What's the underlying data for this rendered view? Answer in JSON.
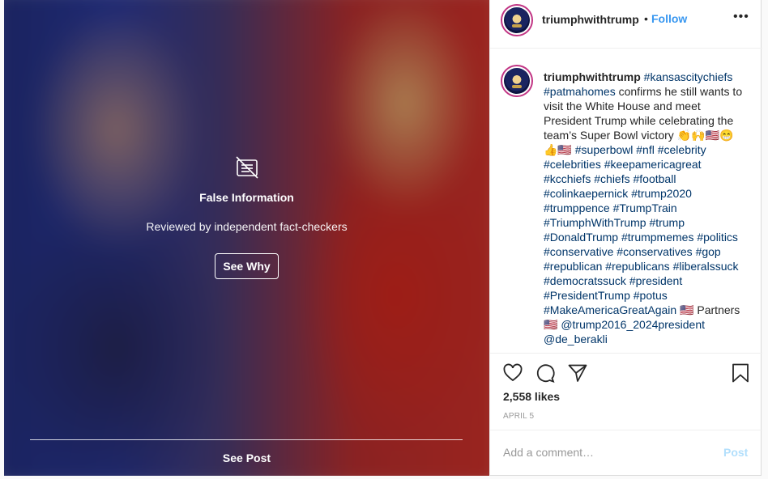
{
  "post": {
    "username": "triumphwithtrump",
    "follow_dot": "•",
    "follow_label": "Follow",
    "more_label": "•••",
    "likes": "2,558 likes",
    "date": "APRIL 5"
  },
  "fact_check": {
    "title": "False Information",
    "reviewed_prefix": "Reviewed by ",
    "reviewed_link": "independent fact-checkers",
    "see_why": "See Why",
    "see_post": "See Post"
  },
  "caption": {
    "username": "triumphwithtrump",
    "segments": [
      {
        "t": "#kansascitychiefs",
        "tag": true
      },
      {
        "t": " ",
        "tag": false
      },
      {
        "t": "#patmahomes",
        "tag": true
      },
      {
        "t": " confirms he still wants to visit the White House and meet President Trump while celebrating the team’s Super Bowl victory 👏🙌🇺🇸😁👍🇺🇸 ",
        "tag": false
      },
      {
        "t": "#superbowl",
        "tag": true
      },
      {
        "t": " ",
        "tag": false
      },
      {
        "t": "#nfl",
        "tag": true
      },
      {
        "t": " ",
        "tag": false
      },
      {
        "t": "#celebrity",
        "tag": true
      },
      {
        "t": " ",
        "tag": false
      },
      {
        "t": "#celebrities",
        "tag": true
      },
      {
        "t": " ",
        "tag": false
      },
      {
        "t": "#keepamericagreat",
        "tag": true
      },
      {
        "t": " ",
        "tag": false
      },
      {
        "t": "#kcchiefs",
        "tag": true
      },
      {
        "t": " ",
        "tag": false
      },
      {
        "t": "#chiefs",
        "tag": true
      },
      {
        "t": " ",
        "tag": false
      },
      {
        "t": "#football",
        "tag": true
      },
      {
        "t": " ",
        "tag": false
      },
      {
        "t": "#colinkaepernick",
        "tag": true
      },
      {
        "t": " ",
        "tag": false
      },
      {
        "t": "#trump2020",
        "tag": true
      },
      {
        "t": " ",
        "tag": false
      },
      {
        "t": "#trumppence",
        "tag": true
      },
      {
        "t": " ",
        "tag": false
      },
      {
        "t": "#TrumpTrain",
        "tag": true
      },
      {
        "t": " ",
        "tag": false
      },
      {
        "t": "#TriumphWithTrump",
        "tag": true
      },
      {
        "t": " ",
        "tag": false
      },
      {
        "t": "#trump",
        "tag": true
      },
      {
        "t": " ",
        "tag": false
      },
      {
        "t": "#DonaldTrump",
        "tag": true
      },
      {
        "t": " ",
        "tag": false
      },
      {
        "t": "#trumpmemes",
        "tag": true
      },
      {
        "t": " ",
        "tag": false
      },
      {
        "t": "#politics",
        "tag": true
      },
      {
        "t": " ",
        "tag": false
      },
      {
        "t": "#conservative",
        "tag": true
      },
      {
        "t": " ",
        "tag": false
      },
      {
        "t": "#conservatives",
        "tag": true
      },
      {
        "t": " ",
        "tag": false
      },
      {
        "t": "#gop",
        "tag": true
      },
      {
        "t": " ",
        "tag": false
      },
      {
        "t": "#republican",
        "tag": true
      },
      {
        "t": " ",
        "tag": false
      },
      {
        "t": "#republicans",
        "tag": true
      },
      {
        "t": " ",
        "tag": false
      },
      {
        "t": "#liberalssuck",
        "tag": true
      },
      {
        "t": " ",
        "tag": false
      },
      {
        "t": "#democratssuck",
        "tag": true
      },
      {
        "t": " ",
        "tag": false
      },
      {
        "t": "#president",
        "tag": true
      },
      {
        "t": " ",
        "tag": false
      },
      {
        "t": "#PresidentTrump",
        "tag": true
      },
      {
        "t": " ",
        "tag": false
      },
      {
        "t": "#potus",
        "tag": true
      },
      {
        "t": " ",
        "tag": false
      },
      {
        "t": "#MakeAmericaGreatAgain",
        "tag": true
      },
      {
        "t": " 🇺🇸 Partners🇺🇸 ",
        "tag": false
      },
      {
        "t": "@trump2016_2024president",
        "tag": true
      },
      {
        "t": " ",
        "tag": false
      },
      {
        "t": "@de_berakli",
        "tag": true
      }
    ]
  },
  "comment": {
    "placeholder": "Add a comment…",
    "post_label": "Post"
  },
  "icons": {
    "fact_check": "no-news-icon",
    "like": "heart-icon",
    "comment": "comment-bubble-icon",
    "share": "paper-plane-icon",
    "save": "bookmark-icon",
    "more": "more-options-icon"
  },
  "colors": {
    "link": "#3897f0",
    "tag": "#003569",
    "avatar_ring": "#c13584",
    "post_disabled": "#b2dffc"
  }
}
